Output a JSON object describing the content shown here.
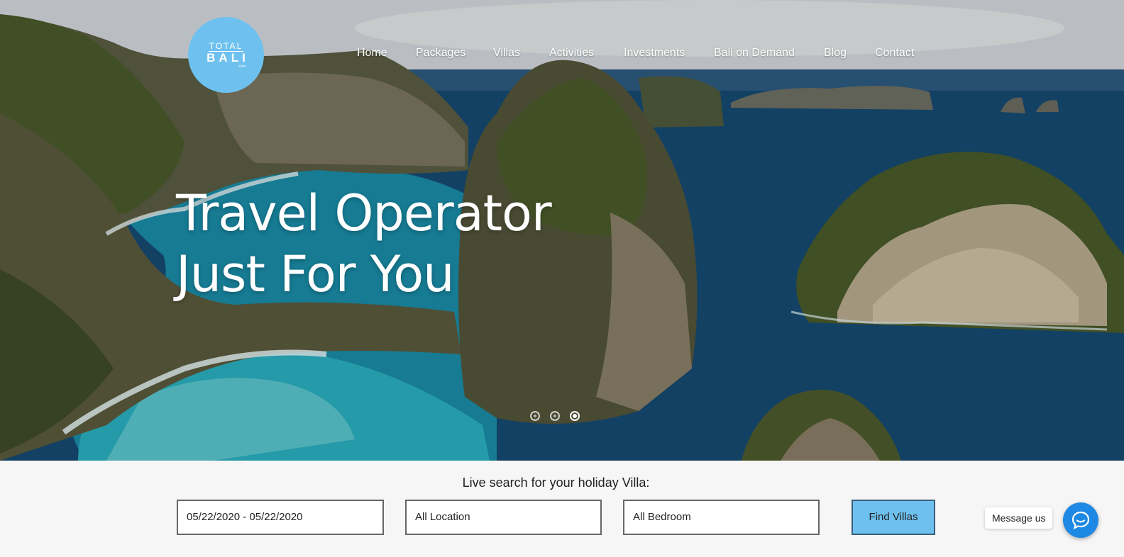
{
  "logo": {
    "line1": "TOTAL",
    "line2": "BALI",
    "line3": ".com"
  },
  "nav": {
    "items": [
      {
        "label": "Home"
      },
      {
        "label": "Packages"
      },
      {
        "label": "Villas"
      },
      {
        "label": "Activities"
      },
      {
        "label": "Investments"
      },
      {
        "label": "Bali on Demand"
      },
      {
        "label": "Blog"
      },
      {
        "label": "Contact"
      }
    ]
  },
  "hero": {
    "headline_line1": "Travel Operator",
    "headline_line2": "Just For You",
    "slides": {
      "count": 3,
      "active_index": 3
    }
  },
  "search": {
    "label": "Live search for your holiday Villa:",
    "date_range": "05/22/2020 - 05/22/2020",
    "location": "All Location",
    "bedroom": "All Bedroom",
    "submit_label": "Find Villas"
  },
  "chat": {
    "label": "Message us"
  },
  "colors": {
    "brand": "#6ec1ef",
    "chat": "#1e88e5"
  }
}
